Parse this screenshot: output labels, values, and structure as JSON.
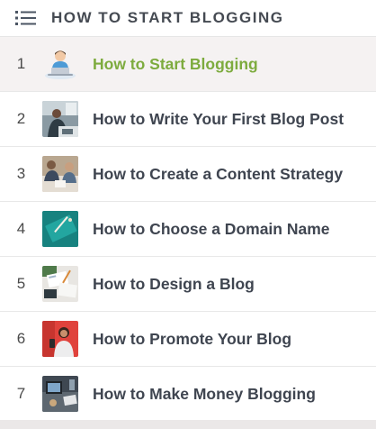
{
  "header": {
    "title": "HOW TO START BLOGGING",
    "icon": "list-icon"
  },
  "items": [
    {
      "number": "1",
      "label": "How to Start Blogging",
      "thumbnail": "person-at-laptop-illustration",
      "active": true
    },
    {
      "number": "2",
      "label": "How to Write Your First Blog Post",
      "thumbnail": "person-writing-photo",
      "active": false
    },
    {
      "number": "3",
      "label": "How to Create a Content Strategy",
      "thumbnail": "team-meeting-photo",
      "active": false
    },
    {
      "number": "4",
      "label": "How to Choose a Domain Name",
      "thumbnail": "laptop-on-teal-photo",
      "active": false
    },
    {
      "number": "5",
      "label": "How to Design a Blog",
      "thumbnail": "design-desk-photo",
      "active": false
    },
    {
      "number": "6",
      "label": "How to Promote Your Blog",
      "thumbnail": "woman-on-red-photo",
      "active": false
    },
    {
      "number": "7",
      "label": "How to Make Money Blogging",
      "thumbnail": "workspace-photo",
      "active": false
    }
  ],
  "colors": {
    "active_label": "#7dab3e",
    "label": "#3f4550",
    "active_row_bg": "#f5f2f2"
  }
}
